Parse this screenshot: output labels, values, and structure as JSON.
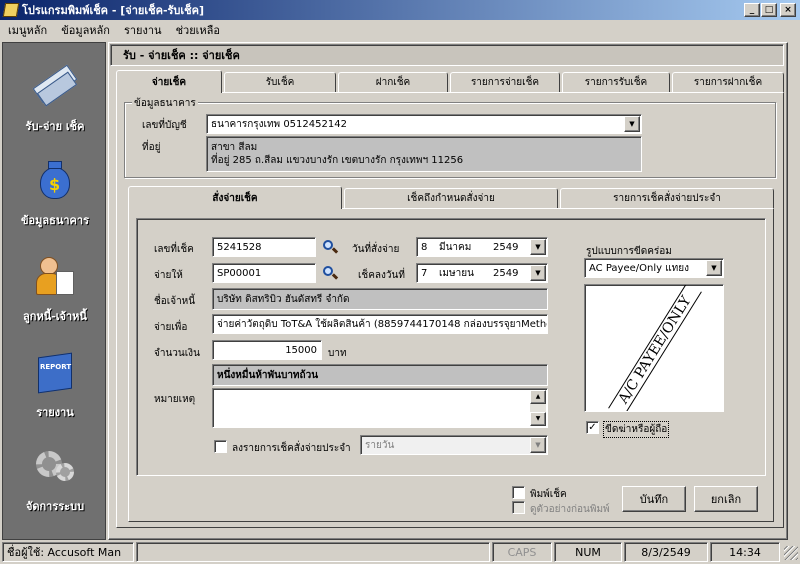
{
  "window": {
    "title": "โปรแกรมพิมพ์เช็ค - [จ่ายเช็ค-รับเช็ค]",
    "min": "_",
    "max": "□",
    "close": "×"
  },
  "menu": [
    "เมนูหลัก",
    "ข้อมูลหลัก",
    "รายงาน",
    "ช่วยเหลือ"
  ],
  "sidebar": [
    {
      "label": "รับ-จ่าย เช็ค",
      "icon": "cheque-icon"
    },
    {
      "label": "ข้อมูลธนาคาร",
      "icon": "money-bag-icon"
    },
    {
      "label": "ลูกหนี้-เจ้าหนี้",
      "icon": "person-document-icon"
    },
    {
      "label": "รายงาน",
      "icon": "report-book-icon"
    },
    {
      "label": "จัดการระบบ",
      "icon": "gears-icon"
    }
  ],
  "report_icon_text": "REPORT",
  "header": "รับ - จ่ายเช็ค :: จ่ายเช็ค",
  "main_tabs": [
    "จ่ายเช็ค",
    "รับเช็ค",
    "ฝากเช็ค",
    "รายการจ่ายเช็ค",
    "รายการรับเช็ค",
    "รายการฝากเช็ค"
  ],
  "bank": {
    "legend": "ข้อมูลธนาคาร",
    "account_label": "เลขที่บัญชี",
    "account_value": "ธนาคารกรุงเทพ   0512452142",
    "address_label": "ที่อยู่",
    "address_line1": "สาขา สีลม",
    "address_line2": "ที่อยู่  285 ถ.สีลม แขวงบางรัก เขตบางรัก   กรุงเทพฯ   11256"
  },
  "sub_tabs": [
    "สั่งจ่ายเช็ค",
    "เช็คถึงกำหนดสั่งจ่าย",
    "รายการเช็คสั่งจ่ายประจำ"
  ],
  "form": {
    "cheque_no_label": "เลขที่เช็ค",
    "cheque_no": "5241528",
    "pay_date_label": "วันที่สั่งจ่าย",
    "pay_date": {
      "day": "8",
      "month": "มีนาคม",
      "year": "2549"
    },
    "pay_to_label": "จ่ายให้",
    "pay_to": "SP00001",
    "cheque_date_label": "เช็คลงวันที่",
    "cheque_date": {
      "day": "7",
      "month": "เมษายน",
      "year": "2549"
    },
    "creditor_label": "ชื่อเจ้าหนี้",
    "creditor_name": "บริษัท ดิสทริบิว ฮันดัสทรี จำกัด",
    "purpose_label": "จ่ายเพื่อ",
    "purpose": "จ่ายค่าวัตถุดิบ ToT&A ใช้ผลิตสินค้า  (8859744170148 กล่องบรรจุยาMetho",
    "amount_label": "จำนวนเงิน",
    "amount": "15000",
    "amount_unit": "บาท",
    "amount_text": "หนึ่งหมื่นห้าพันบาทถ้วน",
    "note_label": "หมายเหตุ",
    "recurring_label": "ลงรายการเช็คสั่งจ่ายประจำ",
    "recurring_option": "รายวัน",
    "cross_label": "รูปแบบการขีดคร่อม",
    "cross_option": "AC Payee/Only แทยง",
    "stamp_text": "A/C PAYEE/ONLY",
    "cross_check_label": "ขีดฆ่าหรือผู้ถือ",
    "cross_checked": "✓",
    "print_label": "พิมพ์เช็ค",
    "preview_label": "ดูตัวอย่างก่อนพิมพ์",
    "save_label": "บันทึก",
    "cancel_label": "ยกเลิก"
  },
  "status": {
    "user": "ชื่อผู้ใช้: Accusoft Man",
    "caps": "CAPS",
    "num": "NUM",
    "date": "8/3/2549",
    "time": "14:34"
  }
}
